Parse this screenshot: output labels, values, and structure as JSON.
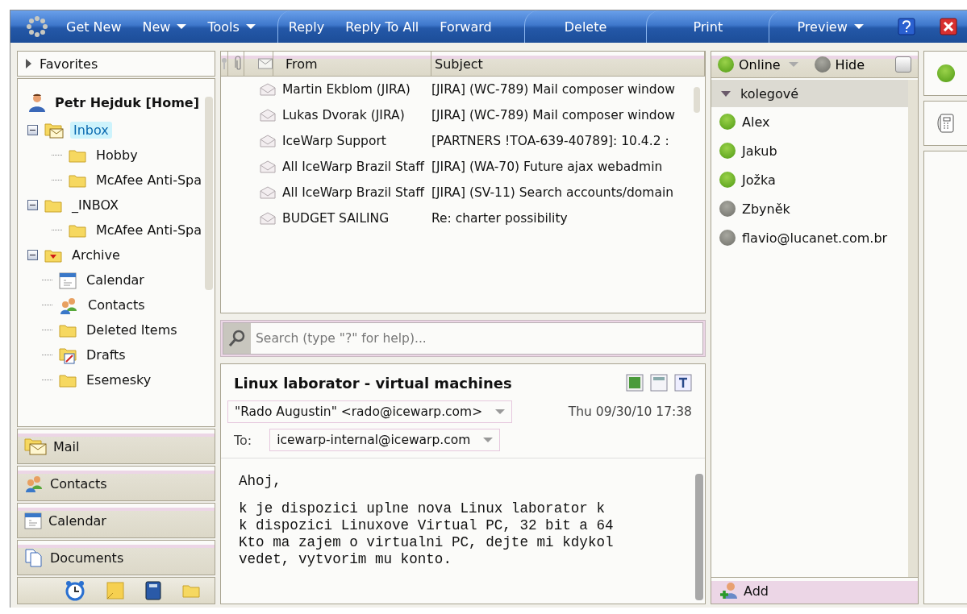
{
  "toolbar": {
    "items": [
      {
        "label": "Get New",
        "dropdown": false,
        "group_start": false
      },
      {
        "label": "New",
        "dropdown": true,
        "group_start": false
      },
      {
        "label": "Tools",
        "dropdown": true,
        "group_start": false
      },
      {
        "label": "Reply",
        "dropdown": false,
        "group_start": true
      },
      {
        "label": "Reply To All",
        "dropdown": false,
        "group_start": false
      },
      {
        "label": "Forward",
        "dropdown": false,
        "group_start": false
      },
      {
        "label": "Delete",
        "dropdown": false,
        "group_start": true
      },
      {
        "label": "Print",
        "dropdown": false,
        "group_start": true
      },
      {
        "label": "Preview",
        "dropdown": true,
        "group_start": true
      }
    ]
  },
  "folders": {
    "header": "Favorites",
    "account": "Petr Hejduk [Home]",
    "items": [
      {
        "label": "Inbox",
        "kind": "inbox",
        "selected": true,
        "expanded": true,
        "children": [
          {
            "label": "Hobby",
            "kind": "folder",
            "selected": false,
            "expanded": false
          },
          {
            "label": "McAfee Anti-Spa",
            "kind": "folder",
            "selected": false,
            "expanded": false
          }
        ]
      },
      {
        "label": "_INBOX",
        "kind": "folder",
        "selected": false,
        "expanded": true,
        "children": [
          {
            "label": "McAfee Anti-Spa",
            "kind": "folder",
            "selected": false,
            "expanded": false
          }
        ]
      },
      {
        "label": "Archive",
        "kind": "archive",
        "selected": false,
        "expanded": true
      },
      {
        "label": "Calendar",
        "kind": "calendar",
        "selected": false,
        "expanded": false
      },
      {
        "label": "Contacts",
        "kind": "contacts",
        "selected": false,
        "expanded": false
      },
      {
        "label": "Deleted Items",
        "kind": "folder",
        "selected": false,
        "expanded": false
      },
      {
        "label": "Drafts",
        "kind": "drafts",
        "selected": false,
        "expanded": false
      },
      {
        "label": "Esemesky",
        "kind": "folder",
        "selected": false,
        "expanded": false
      }
    ],
    "nav": [
      {
        "label": "Mail",
        "kind": "mail"
      },
      {
        "label": "Contacts",
        "kind": "contacts"
      },
      {
        "label": "Calendar",
        "kind": "calendar"
      },
      {
        "label": "Documents",
        "kind": "documents"
      }
    ]
  },
  "message_list": {
    "columns": [
      "From",
      "Subject"
    ],
    "rows": [
      {
        "from": "Martin Ekblom (JIRA)",
        "subject": "[JIRA] (WC-789) Mail composer window"
      },
      {
        "from": "Lukas Dvorak (JIRA)",
        "subject": "[JIRA] (WC-789) Mail composer window"
      },
      {
        "from": "IceWarp Support",
        "subject": "[PARTNERS !TOA-639-40789]: 10.4.2 :"
      },
      {
        "from": "All IceWarp Brazil Staff",
        "subject": "[JIRA] (WA-70) Future ajax webadmin"
      },
      {
        "from": "All IceWarp Brazil Staff",
        "subject": "[JIRA] (SV-11) Search accounts/domain"
      },
      {
        "from": "BUDGET SAILING",
        "subject": "Re: charter possibility"
      }
    ]
  },
  "search": {
    "placeholder": "Search (type \"?\" for help)..."
  },
  "reading_pane": {
    "title": "Linux laborator - virtual machines",
    "from": "\"Rado Augustin\" <rado@icewarp.com>",
    "date": "Thu 09/30/10 17:38",
    "to_label": "To:",
    "to": "icewarp-internal@icewarp.com",
    "greeting": "Ahoj,",
    "body": [
      "k je dispozici uplne nova Linux laborator k",
      "k dispozici Linuxove Virtual PC, 32 bit a 64",
      "Kto ma zajem o virtualni PC, dejte mi kdykol",
      "vedet, vytvorim mu konto."
    ]
  },
  "contacts": {
    "status": "Online",
    "hide": "Hide",
    "group": {
      "label": "kolegové",
      "expanded": true
    },
    "items": [
      {
        "name": "Alex",
        "online": true
      },
      {
        "name": "Jakub",
        "online": true
      },
      {
        "name": "Jožka",
        "online": true
      },
      {
        "name": "Zbyněk",
        "online": false
      },
      {
        "name": "flavio@lucanet.com.br",
        "online": false
      }
    ],
    "add": "Add"
  }
}
